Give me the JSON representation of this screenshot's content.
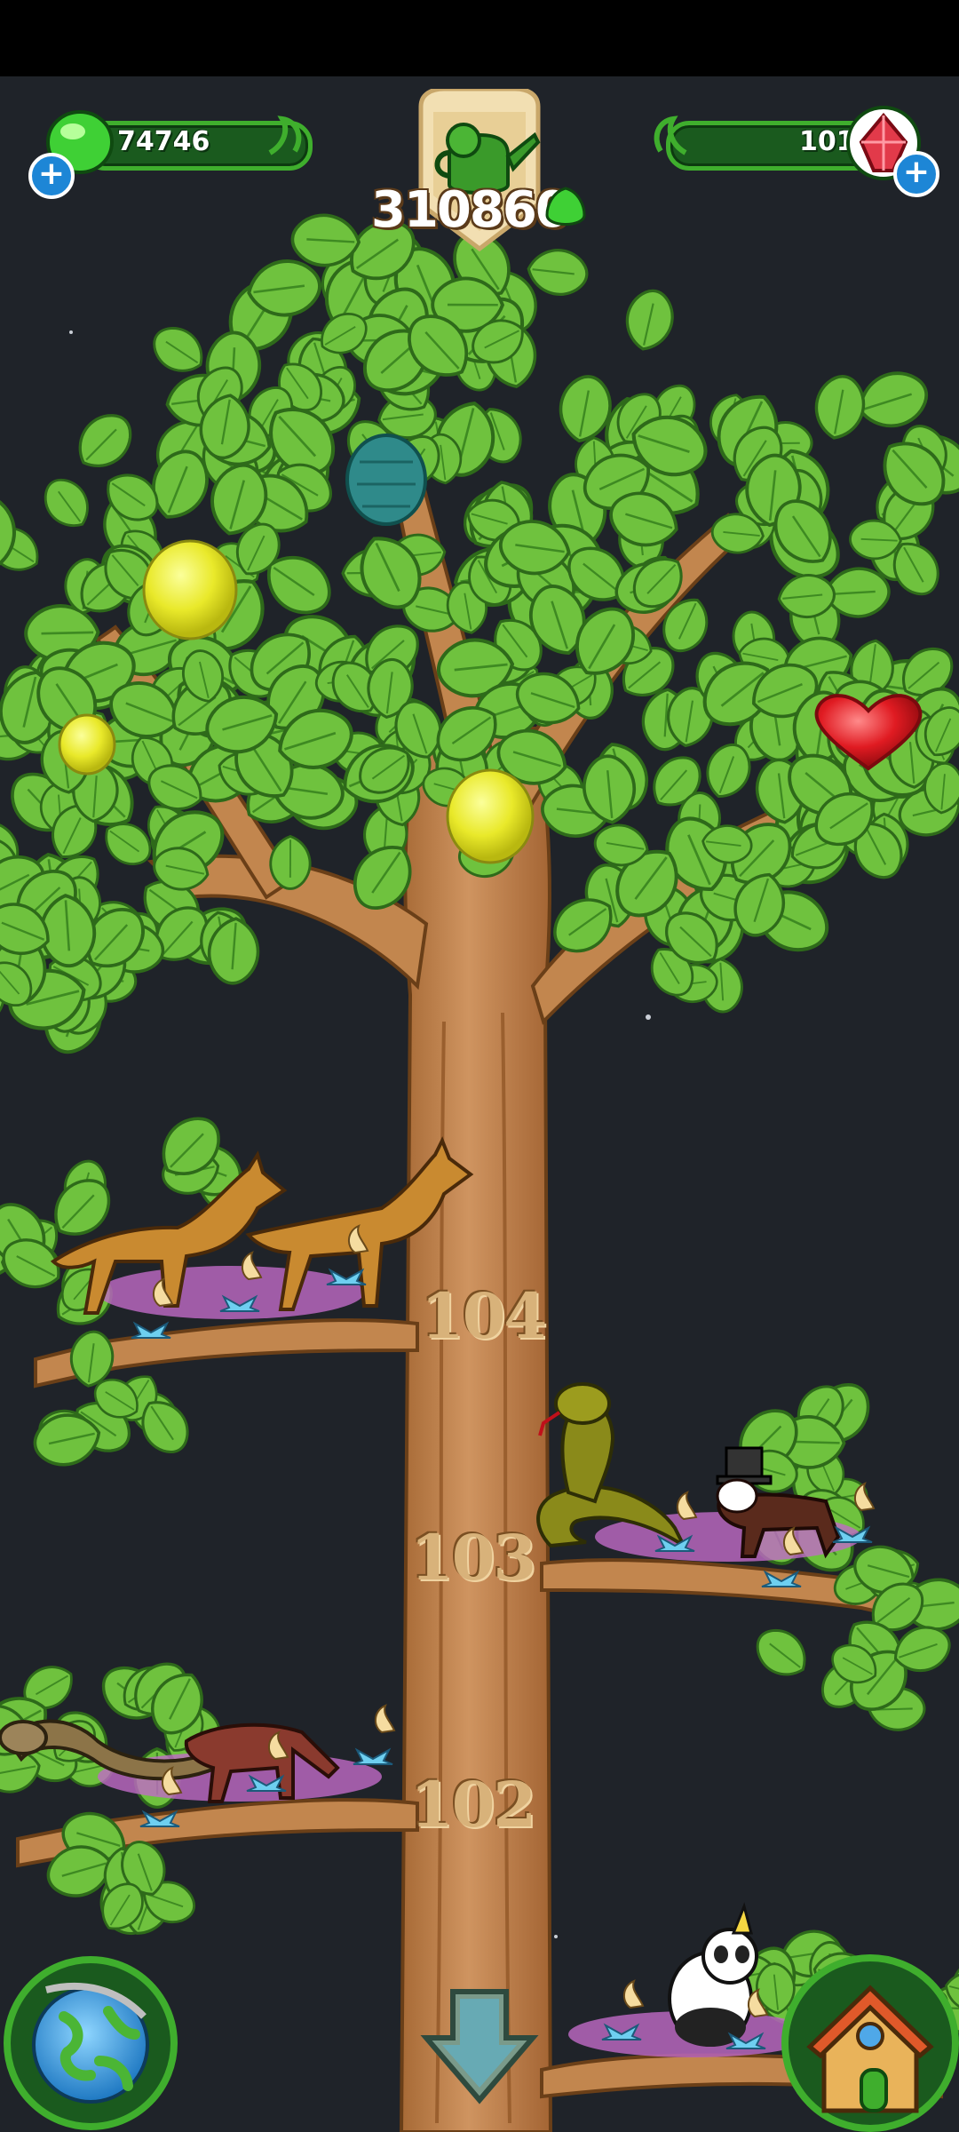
{
  "hud": {
    "gems_green": "74746",
    "gems_red": "101",
    "water_score": "310860",
    "icons": [
      "green-gem-icon",
      "plus-icon",
      "watering-can-icon",
      "red-crystal-icon"
    ]
  },
  "branches": [
    {
      "level": "104",
      "animals": [
        "coyote",
        "coyote"
      ]
    },
    {
      "level": "103",
      "animals": [
        "cobra",
        "top-hat-dog"
      ]
    },
    {
      "level": "102",
      "animals": [
        "rattlesnake",
        "anteater"
      ]
    }
  ],
  "fruits": [
    "teal-pod",
    "yellow-fruit",
    "yellow-fruit",
    "yellow-fruit",
    "red-heart"
  ],
  "nav": {
    "left": "globe-button",
    "center": "scroll-down-button",
    "right": "home-button"
  },
  "colors": {
    "background": "#1f2329",
    "leaf": "#6fc23e",
    "trunk": "#c2864e",
    "hud_green": "#3fae2d"
  }
}
